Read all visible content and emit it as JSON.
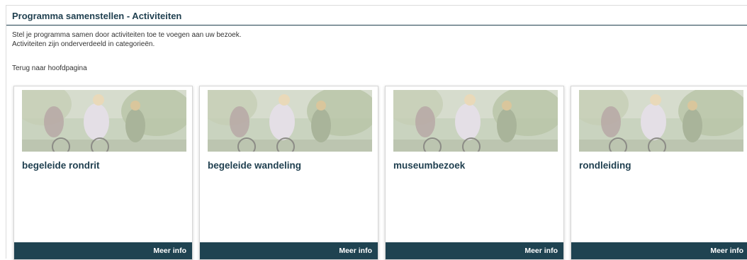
{
  "header": {
    "title": "Programma samenstellen - Activiteiten"
  },
  "intro": {
    "line1": "Stel je programma samen door activiteiten toe te voegen aan uw bezoek.",
    "line2": "Activiteiten zijn onderverdeeld in categorieën."
  },
  "back_link": "Terug naar hoofdpagina",
  "cards": [
    {
      "title": "begeleide rondrit",
      "button": "Meer info"
    },
    {
      "title": "begeleide wandeling",
      "button": "Meer info"
    },
    {
      "title": "museumbezoek",
      "button": "Meer info"
    },
    {
      "title": "rondleiding",
      "button": "Meer info"
    }
  ],
  "colors": {
    "accent": "#1f4351",
    "title": "#1f3f4f"
  }
}
